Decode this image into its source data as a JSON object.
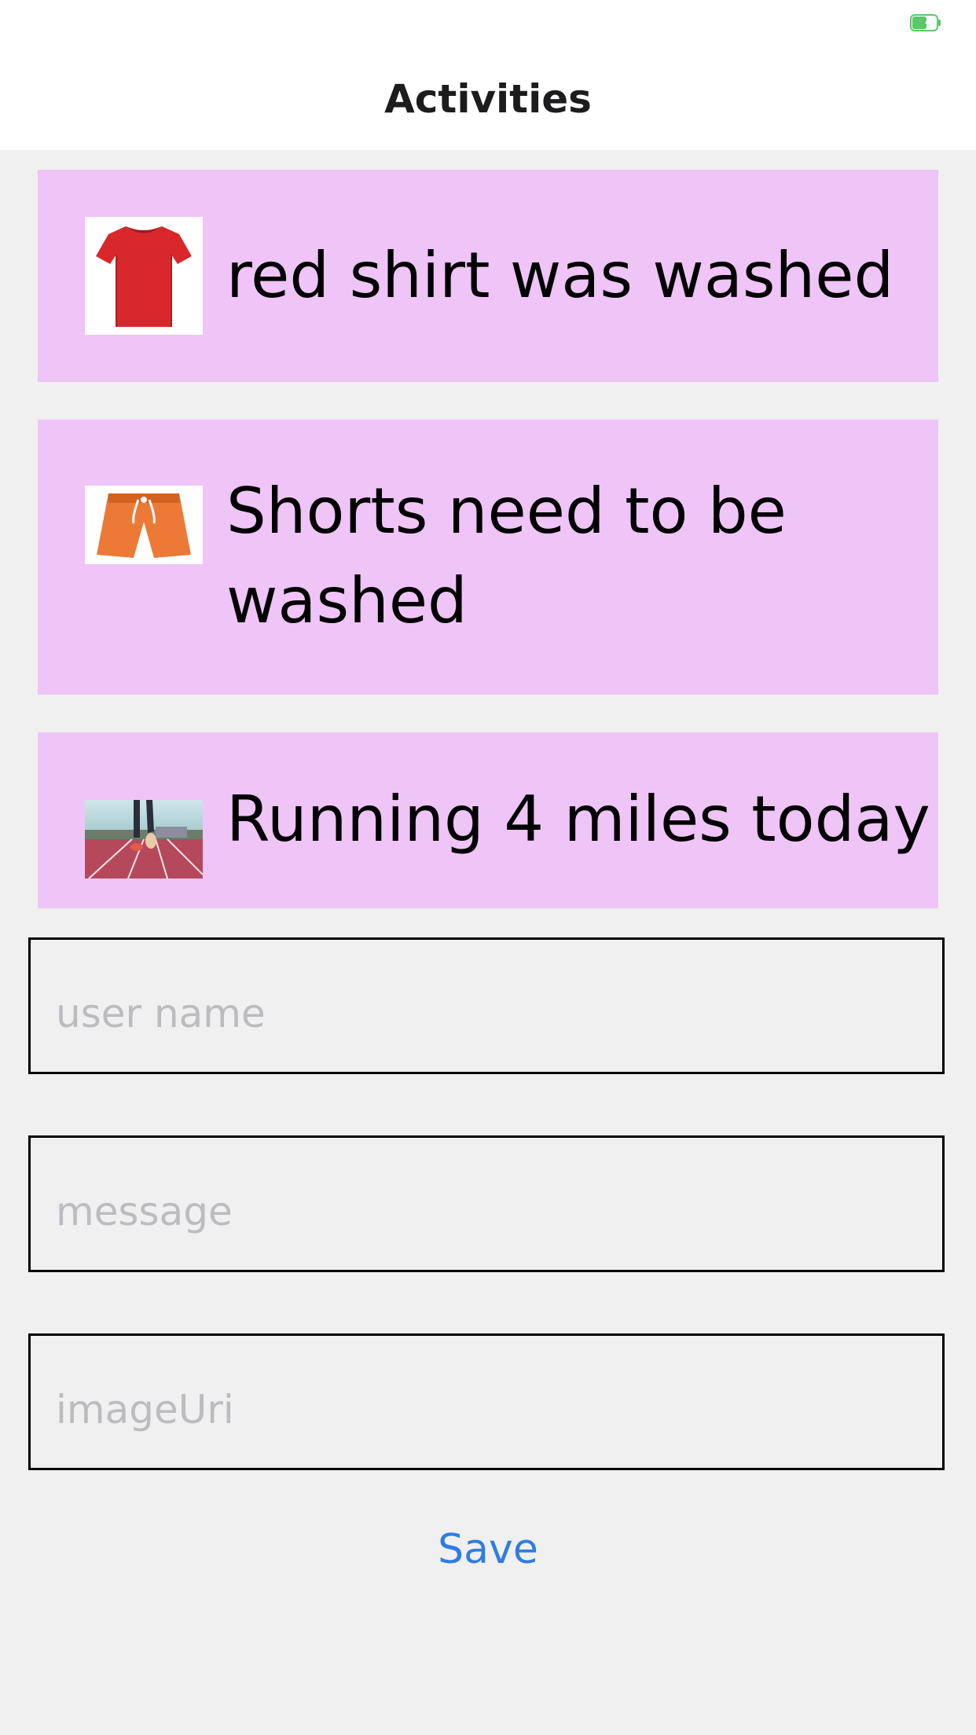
{
  "header": {
    "title": "Activities"
  },
  "status_bar": {
    "battery_icon": "battery-charging-icon",
    "battery_color": "#5bc66a"
  },
  "activities": [
    {
      "message": "red shirt was washed",
      "image_icon": "red-tshirt-image"
    },
    {
      "message": "Shorts need to be washed",
      "image_icon": "orange-shorts-image"
    },
    {
      "message": "Running 4 miles today",
      "image_icon": "running-track-image"
    }
  ],
  "form": {
    "username_placeholder": "user name",
    "message_placeholder": "message",
    "imageuri_placeholder": "imageUri",
    "save_label": "Save"
  },
  "colors": {
    "card_background": "#efc4f7",
    "page_background": "#f0f0f0",
    "accent": "#2f7de1",
    "placeholder": "#bcbcc0"
  }
}
